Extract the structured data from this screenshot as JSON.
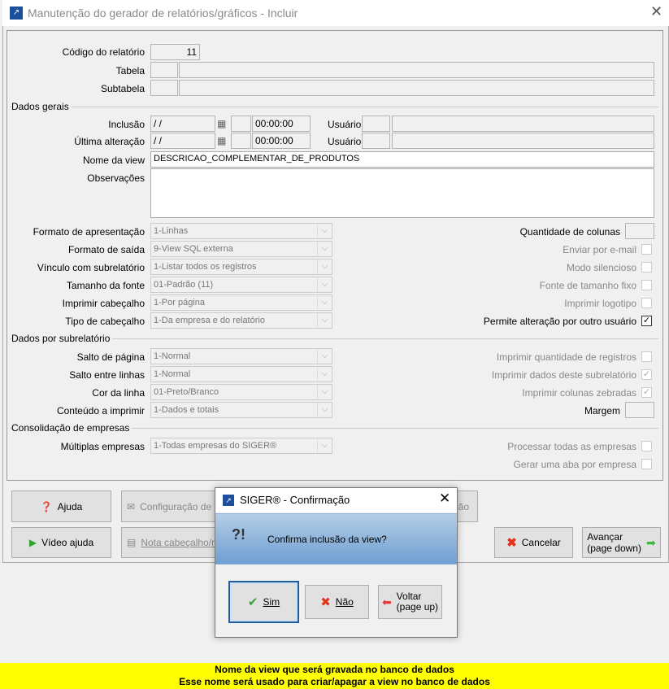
{
  "window": {
    "title": "Manutenção do gerador de relatórios/gráficos - Incluir"
  },
  "fields": {
    "codigo_label": "Código do relatório",
    "codigo_value": "11",
    "tabela_label": "Tabela",
    "subtabela_label": "Subtabela",
    "dados_gerais": "Dados gerais",
    "inclusao_label": "Inclusão",
    "inclusao_date": " / /",
    "inclusao_time": "00:00:00",
    "alteracao_label": "Última alteração",
    "alteracao_date": " / /",
    "alteracao_time": "00:00:00",
    "usuario_label": "Usuário",
    "nome_view_label": "Nome da view",
    "nome_view_value": "DESCRICAO_COMPLEMENTAR_DE_PRODUTOS",
    "observacoes_label": "Observações"
  },
  "selects_gerais": [
    {
      "label": "Formato de apresentação",
      "value": "1-Linhas"
    },
    {
      "label": "Formato de saída",
      "value": "9-View SQL externa"
    },
    {
      "label": "Vínculo com subrelatório",
      "value": "1-Listar todos os registros"
    },
    {
      "label": "Tamanho da fonte",
      "value": "01-Padrão (11)"
    },
    {
      "label": "Imprimir cabeçalho",
      "value": "1-Por página"
    },
    {
      "label": "Tipo de cabeçalho",
      "value": "1-Da empresa e do relatório"
    }
  ],
  "right_gerais": {
    "qtd_colunas": "Quantidade de colunas",
    "checks": [
      {
        "label": "Enviar por e-mail",
        "checked": false
      },
      {
        "label": "Modo silencioso",
        "checked": false
      },
      {
        "label": "Fonte de tamanho fixo",
        "checked": false
      },
      {
        "label": "Imprimir logotipo",
        "checked": false
      },
      {
        "label": "Permite alteração por outro usuário",
        "checked": true
      }
    ]
  },
  "dados_sub": "Dados por subrelatório",
  "selects_sub": [
    {
      "label": "Salto de página",
      "value": "1-Normal"
    },
    {
      "label": "Salto entre linhas",
      "value": "1-Normal"
    },
    {
      "label": "Cor da linha",
      "value": "01-Preto/Branco"
    },
    {
      "label": "Conteúdo a imprimir",
      "value": "1-Dados e totais"
    }
  ],
  "checks_sub": [
    {
      "label": "Imprimir quantidade de registros",
      "checked": false
    },
    {
      "label": "Imprimir dados deste subrelatório",
      "checked": true
    },
    {
      "label": "Imprimir colunas zebradas",
      "checked": true
    }
  ],
  "margem_label": "Margem",
  "consolidacao": "Consolidação de empresas",
  "multiplas": {
    "label": "Múltiplas empresas",
    "value": "1-Todas empresas do SIGER®"
  },
  "checks_cons": [
    {
      "label": "Processar todas as empresas",
      "checked": false
    },
    {
      "label": "Gerar uma aba por empresa",
      "checked": false
    }
  ],
  "buttons": {
    "ajuda": "Ajuda",
    "video": "Vídeo ajuda",
    "config": "Configuração de e-",
    "hidden_right": "ão",
    "nota": "Nota cabeçalho/ro",
    "cancelar": "Cancelar",
    "avancar1": "Avançar",
    "avancar2": "(page down)"
  },
  "dialog": {
    "title": "SIGER® - Confirmação",
    "message": "Confirma inclusão da view?",
    "sim": "Sim",
    "nao": "Não",
    "voltar1": "Voltar",
    "voltar2": "(page up)"
  },
  "status": {
    "line1": "Nome da view que será gravada no banco de dados",
    "line2": "Esse nome será usado para criar/apagar a view no banco de dados"
  }
}
